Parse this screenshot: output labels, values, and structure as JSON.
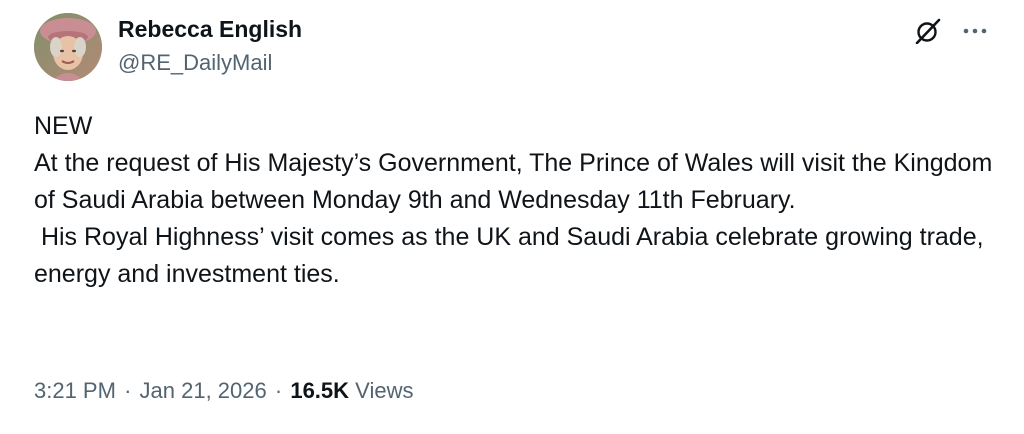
{
  "author": {
    "display_name": "Rebecca English",
    "handle": "@RE_DailyMail"
  },
  "tweet": {
    "text": "NEW\nAt the request of His Majesty’s Government, The Prince of Wales will visit the Kingdom of Saudi Arabia between Monday 9th and Wednesday 11th February.\n His Royal Highness’ visit comes as the UK and Saudi Arabia celebrate growing trade, energy and investment ties."
  },
  "meta": {
    "time": "3:21 PM",
    "separator": "·",
    "date": "Jan 21, 2026",
    "views_count": "16.5K",
    "views_label": "Views"
  },
  "icons": {
    "grok": "grok-icon",
    "more": "more-options-icon"
  },
  "colors": {
    "text_primary": "#0f1419",
    "text_secondary": "#536471",
    "background": "#ffffff"
  }
}
